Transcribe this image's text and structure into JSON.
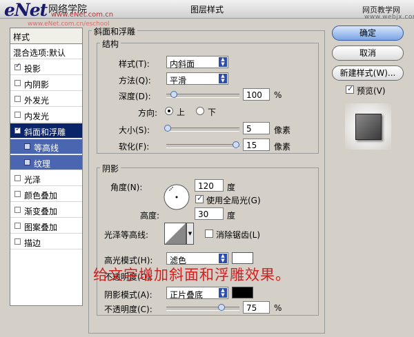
{
  "window": {
    "title": "图层样式",
    "watermark_left_logo": "eNet",
    "watermark_left_cn": "网络学院",
    "watermark_left_url": "www.eNet.com.cn",
    "watermark_left_url2": "www.eNet.com.cn/eschool",
    "watermark_right_cn": "网页教学网",
    "watermark_right_url": "www.webjx.com"
  },
  "sidebar": {
    "header": "样式",
    "items": [
      {
        "label": "混合选项:默认",
        "has_checkbox": false,
        "checked": false,
        "state": "normal"
      },
      {
        "label": "投影",
        "has_checkbox": true,
        "checked": true,
        "state": "normal"
      },
      {
        "label": "内阴影",
        "has_checkbox": true,
        "checked": false,
        "state": "normal"
      },
      {
        "label": "外发光",
        "has_checkbox": true,
        "checked": false,
        "state": "normal"
      },
      {
        "label": "内发光",
        "has_checkbox": true,
        "checked": false,
        "state": "normal"
      },
      {
        "label": "斜面和浮雕",
        "has_checkbox": true,
        "checked": true,
        "state": "selected"
      },
      {
        "label": "等高线",
        "has_checkbox": true,
        "checked": false,
        "state": "sub"
      },
      {
        "label": "纹理",
        "has_checkbox": true,
        "checked": false,
        "state": "sub"
      },
      {
        "label": "光泽",
        "has_checkbox": true,
        "checked": false,
        "state": "normal"
      },
      {
        "label": "颜色叠加",
        "has_checkbox": true,
        "checked": false,
        "state": "normal"
      },
      {
        "label": "渐变叠加",
        "has_checkbox": true,
        "checked": false,
        "state": "normal"
      },
      {
        "label": "图案叠加",
        "has_checkbox": true,
        "checked": false,
        "state": "normal"
      },
      {
        "label": "描边",
        "has_checkbox": true,
        "checked": false,
        "state": "normal"
      }
    ]
  },
  "bevel": {
    "section_title": "斜面和浮雕",
    "structure": {
      "title": "结构",
      "style_label": "样式(T):",
      "style_value": "内斜面",
      "technique_label": "方法(Q):",
      "technique_value": "平滑",
      "depth_label": "深度(D):",
      "depth_value": "100",
      "depth_unit": "%",
      "depth_slider_fraction": 0.1,
      "direction_label": "方向:",
      "direction_up": "上",
      "direction_down": "下",
      "direction_selected": "up",
      "size_label": "大小(S):",
      "size_value": "5",
      "size_unit": "像素",
      "size_slider_fraction": 0.02,
      "soften_label": "软化(F):",
      "soften_value": "15",
      "soften_unit": "像素",
      "soften_slider_fraction": 0.95
    },
    "shading": {
      "title": "阴影",
      "angle_label": "角度(N):",
      "angle_value": "120",
      "angle_unit": "度",
      "global_light_label": "使用全局光(G)",
      "global_light_checked": true,
      "altitude_label": "高度:",
      "altitude_value": "30",
      "altitude_unit": "度",
      "gloss_contour_label": "光泽等高线:",
      "antialias_label": "消除锯齿(L)",
      "antialias_checked": false,
      "highlight_mode_label": "高光模式(H):",
      "highlight_mode_value": "滤色",
      "highlight_color": "#ffffff",
      "highlight_opacity_label": "不透明度(O):",
      "shadow_mode_label": "阴影模式(A):",
      "shadow_mode_value": "正片叠底",
      "shadow_color": "#000000",
      "shadow_opacity_label": "不透明度(C):",
      "shadow_opacity_value": "75",
      "shadow_opacity_unit": "%",
      "shadow_opacity_slider_fraction": 0.75
    }
  },
  "buttons": {
    "ok": "确定",
    "cancel": "取消",
    "new_style": "新建样式(W)...",
    "preview_label": "预览(V)",
    "preview_checked": true
  },
  "overlay_caption": "给文字增加斜面和浮雕效果。"
}
